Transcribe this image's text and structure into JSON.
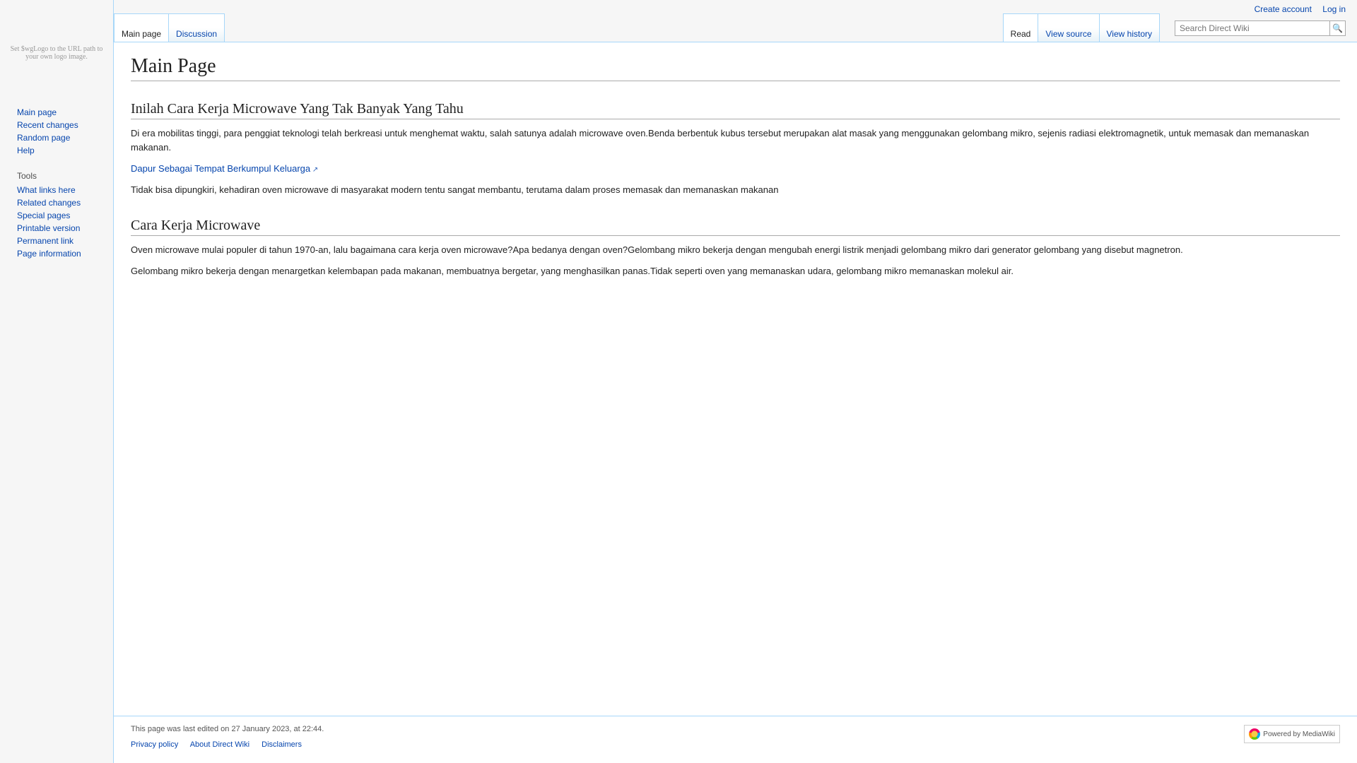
{
  "personal": {
    "create_account": "Create account",
    "log_in": "Log in"
  },
  "tabs_left": {
    "main_page": "Main page",
    "discussion": "Discussion"
  },
  "tabs_right": {
    "read": "Read",
    "view_source": "View source",
    "view_history": "View history"
  },
  "search": {
    "placeholder": "Search Direct Wiki",
    "go": "Go"
  },
  "page_title": "Main Page",
  "logo_hint": "Set $wgLogo to the URL path to your own logo image.",
  "sections": {
    "s1": {
      "heading": "Inilah Cara Kerja Microwave Yang Tak Banyak Yang Tahu",
      "p1": "Di era mobilitas tinggi, para penggiat teknologi telah berkreasi untuk menghemat waktu, salah satunya adalah microwave oven.Benda berbentuk kubus tersebut merupakan alat masak yang menggunakan gelombang mikro, sejenis radiasi elektromagnetik, untuk memasak dan memanaskan makanan.",
      "link": "Dapur Sebagai Tempat Berkumpul Keluarga",
      "p2": "Tidak bisa dipungkiri, kehadiran oven microwave di masyarakat modern tentu sangat membantu, terutama dalam proses memasak dan memanaskan makanan"
    },
    "s2": {
      "heading": "Cara Kerja Microwave",
      "p1": "Oven microwave mulai populer di tahun 1970-an, lalu bagaimana cara kerja oven microwave?Apa bedanya dengan oven?Gelombang mikro bekerja dengan mengubah energi listrik menjadi gelombang mikro dari generator gelombang yang disebut magnetron.",
      "p2": "Gelombang mikro bekerja dengan menargetkan kelembapan pada makanan, membuatnya bergetar, yang menghasilkan panas.Tidak seperti oven yang memanaskan udara, gelombang mikro memanaskan molekul air."
    }
  },
  "nav": {
    "main_page": "Main page",
    "recent_changes": "Recent changes",
    "random_page": "Random page",
    "help": "Help"
  },
  "tools": {
    "heading": "Tools",
    "what_links_here": "What links here",
    "related_changes": "Related changes",
    "special_pages": "Special pages",
    "printable_version": "Printable version",
    "permanent_link": "Permanent link",
    "page_information": "Page information"
  },
  "footer": {
    "lastmod": "This page was last edited on 27 January 2023, at 22:44.",
    "privacy": "Privacy policy",
    "about": "About Direct Wiki",
    "disclaimers": "Disclaimers",
    "badge": "Powered by MediaWiki"
  }
}
